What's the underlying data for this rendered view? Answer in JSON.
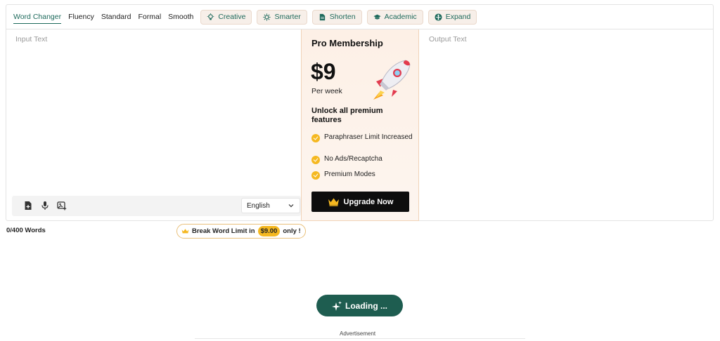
{
  "modes": {
    "tabs": [
      "Word Changer",
      "Fluency",
      "Standard",
      "Formal",
      "Smooth"
    ],
    "active": "Word Changer",
    "premium": [
      {
        "label": "Creative",
        "icon": "lightbulb-icon"
      },
      {
        "label": "Smarter",
        "icon": "brain-icon"
      },
      {
        "label": "Shorten",
        "icon": "document-icon"
      },
      {
        "label": "Academic",
        "icon": "graduation-cap-icon"
      },
      {
        "label": "Expand",
        "icon": "expand-arrows-icon"
      }
    ]
  },
  "input": {
    "placeholder": "Input Text",
    "language": "English",
    "tools": [
      "upload-file-icon",
      "microphone-icon",
      "image-scan-icon"
    ]
  },
  "promo": {
    "title": "Pro Membership",
    "price": "$9",
    "period": "Per week",
    "unlock": "Unlock all premium features",
    "features": [
      "Paraphraser Limit Increased",
      "No Ads/Recaptcha",
      "Premium Modes"
    ],
    "cta": "Upgrade Now"
  },
  "output": {
    "placeholder": "Output Text"
  },
  "footer": {
    "word_count": "0/400 Words",
    "limit_prefix": "Break Word Limit in",
    "limit_price": "$9.00",
    "limit_suffix": "only !",
    "loading": "Loading ...",
    "ad_label": "Advertisement"
  },
  "colors": {
    "accent": "#1e6a5c",
    "button_dark": "#1e5d50",
    "gold": "#f5b820",
    "promo_bg": "#fdf0e6"
  }
}
